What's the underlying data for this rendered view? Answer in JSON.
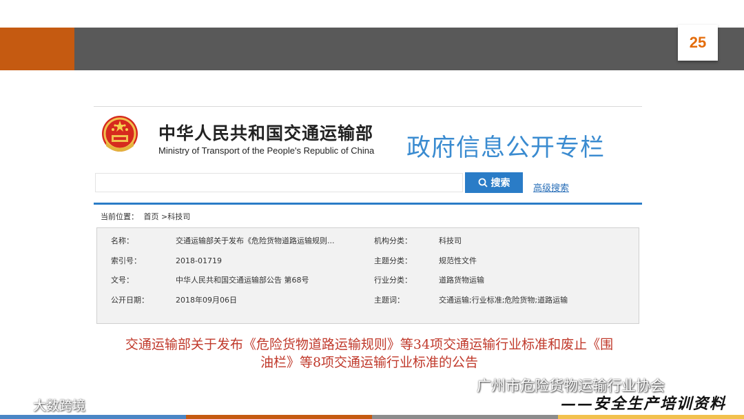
{
  "slide": {
    "page_number": "25"
  },
  "site": {
    "ministry_cn": "中华人民共和国交通运输部",
    "ministry_en": "Ministry of Transport of the People's Republic of China",
    "column_title": "政府信息公开专栏"
  },
  "search": {
    "value": "",
    "button_label": "搜索",
    "advanced_label": "高级搜索"
  },
  "breadcrumb": {
    "label": "当前位置：",
    "items": [
      "首页",
      ">科技司"
    ]
  },
  "meta": {
    "rows": [
      {
        "k1": "名称：",
        "v1": "交通运输部关于发布《危险货物道路运输规则...",
        "k2": "机构分类：",
        "v2": "科技司"
      },
      {
        "k1": "索引号：",
        "v1": "2018-01719",
        "k2": "主题分类：",
        "v2": "规范性文件"
      },
      {
        "k1": "文号：",
        "v1": "中华人民共和国交通运输部公告 第68号",
        "k2": "行业分类：",
        "v2": "道路货物运输"
      },
      {
        "k1": "公开日期：",
        "v1": "2018年09月06日",
        "k2": "主题词：",
        "v2": "交通运输;行业标准;危险货物;道路运输"
      }
    ]
  },
  "headline": {
    "line1": "交通运输部关于发布《危险货物道路运输规则》等34项交通运输行业标准和废止《围",
    "line2": "油栏》等8项交通运输行业标准的公告"
  },
  "footer": {
    "association": "广州市危险货物运输行业协会",
    "slogan": "——安全生产培训资料",
    "watermark": "大数跨境"
  },
  "colors": {
    "accent_orange": "#c55a11",
    "band_gray": "#595959",
    "page_number": "#e46c0a",
    "link_blue": "#2a7cc7",
    "headline_red": "#c0392b"
  }
}
